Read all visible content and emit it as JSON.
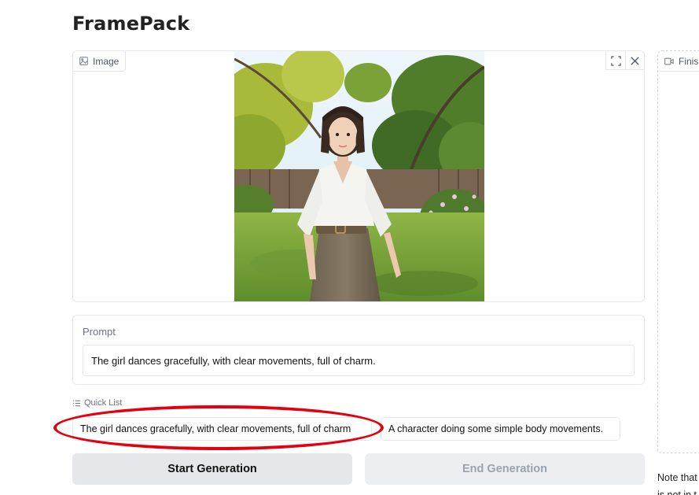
{
  "app": {
    "title": "FramePack"
  },
  "image_panel": {
    "label": "Image",
    "icon": "image-icon",
    "tools": [
      "fullscreen-icon",
      "close-icon"
    ]
  },
  "video_panel": {
    "label": "Finis",
    "icon": "video-icon"
  },
  "prompt": {
    "label": "Prompt",
    "value": "The girl dances gracefully, with clear movements, full of charm."
  },
  "quick_list": {
    "label": "Quick List",
    "items": [
      {
        "label": "The girl dances gracefully, with clear movements, full of charm"
      },
      {
        "label": "A character doing some simple body movements."
      }
    ]
  },
  "buttons": {
    "start": "Start Generation",
    "end": "End Generation"
  },
  "note": {
    "line1": "Note that",
    "line2": "is not in t"
  },
  "colors": {
    "highlight": "#e3000f",
    "button_bg": "#e5e7eb",
    "disabled_text": "#9ca3af"
  }
}
